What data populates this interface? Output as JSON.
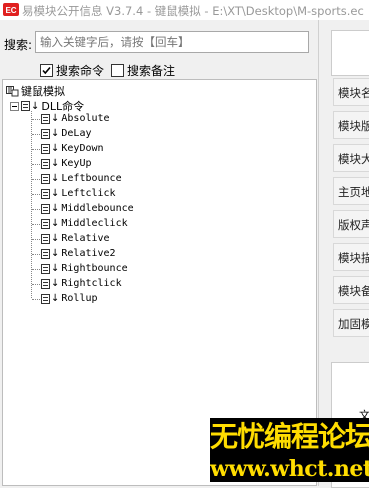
{
  "window": {
    "title": "易模块公开信息 V3.7.4 - 键鼠模拟 - E:\\XT\\Desktop\\M-sports.ec"
  },
  "search": {
    "label": "搜索:",
    "placeholder": "输入关键字后，请按【回车】"
  },
  "options": {
    "search_commands": {
      "label": "搜索命令",
      "checked": true
    },
    "search_notes": {
      "label": "搜索备注",
      "checked": false
    }
  },
  "tree": {
    "root": "键鼠模拟",
    "group": "DLL命令",
    "items": [
      "Absolute",
      "DeLay",
      "KeyDown",
      "KeyUp",
      "Leftbounce",
      "Leftclick",
      "Middlebounce",
      "Middleclick",
      "Relative",
      "Relative2",
      "Rightbounce",
      "Rightclick",
      "Rollup"
    ]
  },
  "right_panel": {
    "rows": [
      "模块名",
      "模块版",
      "模块大",
      "主页地",
      "版权声",
      "模块描",
      "模块备",
      "加固模"
    ],
    "fragment": "文"
  },
  "watermark": {
    "line1": "无忧编程论坛",
    "line2": "www.whct.net"
  }
}
